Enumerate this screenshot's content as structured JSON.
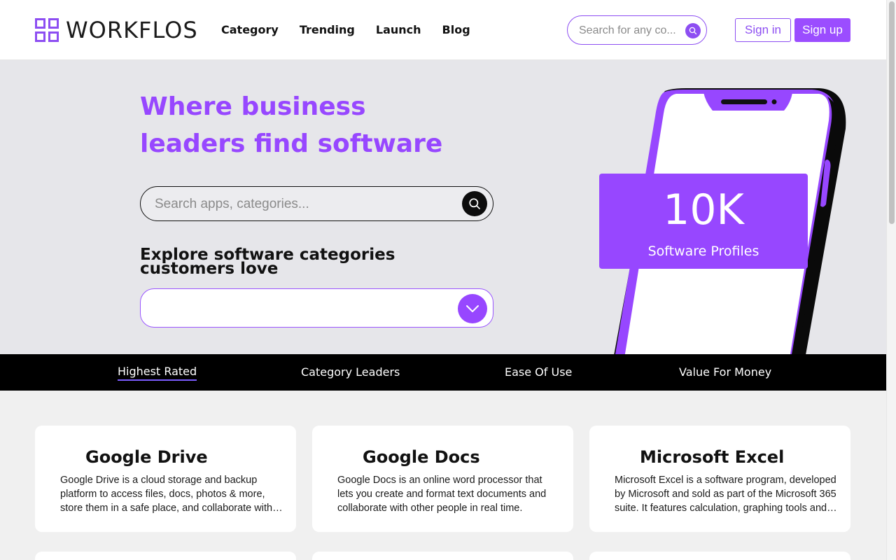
{
  "header": {
    "brand": "WORKFLOS",
    "nav": [
      "Category",
      "Trending",
      "Launch",
      "Blog"
    ],
    "search_placeholder": "Search for any co...",
    "signin_label": "Sign in",
    "signup_label": "Sign up"
  },
  "hero": {
    "title": "Where business leaders find software",
    "search_placeholder": "Search apps, categories...",
    "explore_title": "Explore software categories customers love",
    "dropdown_value": "",
    "stat_value": "10K",
    "stat_label": "Software Profiles"
  },
  "tabs": [
    {
      "label": "Highest Rated",
      "active": true
    },
    {
      "label": "Category Leaders",
      "active": false
    },
    {
      "label": "Ease Of Use",
      "active": false
    },
    {
      "label": "Value For Money",
      "active": false
    }
  ],
  "cards": [
    {
      "title": "Google Drive",
      "desc": "Google Drive is a cloud storage and backup platform to access files, docs, photos & more, store them in a safe place, and collaborate with others from any device."
    },
    {
      "title": "Google Docs",
      "desc": "Google Docs is an online word processor that lets you create and format text documents and collaborate with other people in real time."
    },
    {
      "title": "Microsoft Excel",
      "desc": "Microsoft Excel is a software program, developed by Microsoft and sold as part of the Microsoft 365 suite. It features calculation, graphing tools and pivot tables."
    }
  ],
  "colors": {
    "accent": "#9747ff",
    "tab_bar": "#000000",
    "hero_bg": "#e6e6ea"
  }
}
